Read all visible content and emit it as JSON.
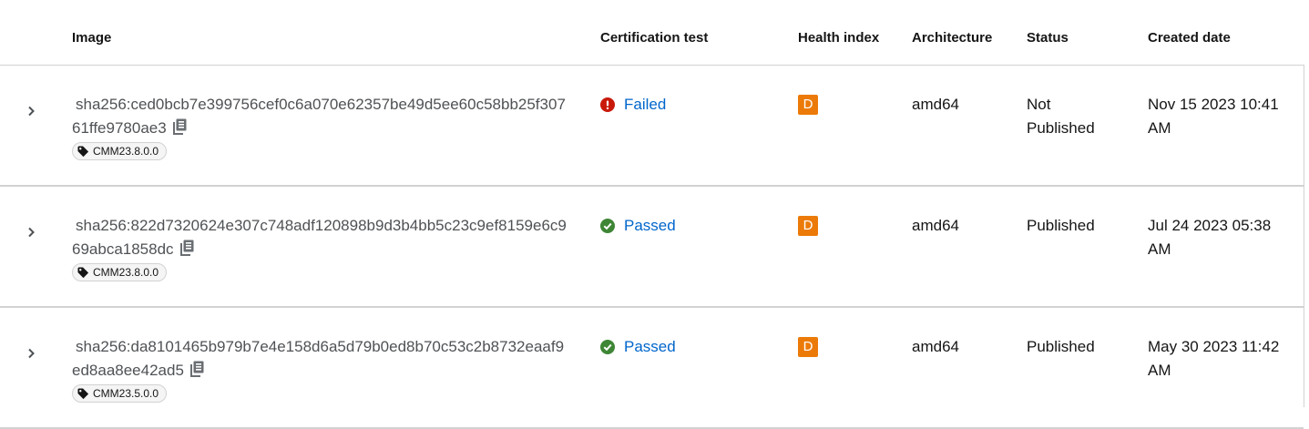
{
  "columns": {
    "image": "Image",
    "certification": "Certification test",
    "health": "Health index",
    "architecture": "Architecture",
    "status": "Status",
    "created": "Created date"
  },
  "rows": [
    {
      "digest": "sha256:ced0bcb7e399756cef0c6a070e62357be49d5ee60c58bb25f30761ffe9780ae3",
      "tag": "CMM23.8.0.0",
      "certification": "Failed",
      "certification_state": "failed",
      "health": "D",
      "architecture": "amd64",
      "status": "Not Published",
      "created": "Nov 15 2023 10:41 AM"
    },
    {
      "digest": "sha256:822d7320624e307c748adf120898b9d3b4bb5c23c9ef8159e6c969abca1858dc",
      "tag": "CMM23.8.0.0",
      "certification": "Passed",
      "certification_state": "passed",
      "health": "D",
      "architecture": "amd64",
      "status": "Published",
      "created": "Jul 24 2023 05:38 AM"
    },
    {
      "digest": "sha256:da8101465b979b7e4e158d6a5d79b0ed8b70c53c2b8732eaaf9ed8aa8ee42ad5",
      "tag": "CMM23.5.0.0",
      "certification": "Passed",
      "certification_state": "passed",
      "health": "D",
      "architecture": "amd64",
      "status": "Published",
      "created": "May 30 2023 11:42 AM"
    }
  ],
  "colors": {
    "link": "#0066cc",
    "failed": "#c9190b",
    "passed": "#3e8635",
    "grade_d": "#ec7a08",
    "border": "#d2d2d2"
  },
  "icons": {
    "expand": "chevron-right-icon",
    "copy": "copy-icon",
    "tag": "tag-icon",
    "failed": "exclamation-circle-icon",
    "passed": "check-circle-icon"
  }
}
